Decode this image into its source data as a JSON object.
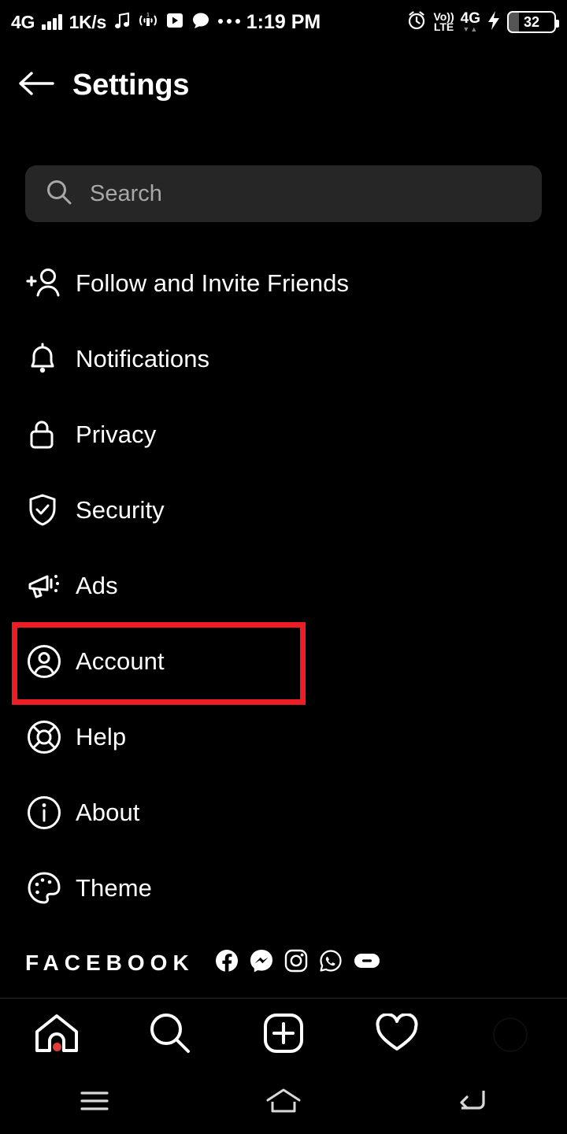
{
  "statusbar": {
    "network_type": "4G",
    "signal_icon": "signal-bars-icon",
    "data_rate": "1K/s",
    "music_icon": "music-note-icon",
    "cast_icon": "nearby-share-icon",
    "video_icon": "play-video-icon",
    "chat_icon": "chat-bubble-icon",
    "more_icon": "more-dots-icon",
    "time": "1:19 PM",
    "alarm_icon": "alarm-clock-icon",
    "volte_top": "Vo))",
    "volte_bottom": "LTE",
    "data_network": "4G",
    "data_arrows": "▼▲",
    "charging_icon": "charging-bolt-icon",
    "battery_level": "32"
  },
  "header": {
    "back_icon": "back-arrow-icon",
    "title": "Settings"
  },
  "search": {
    "icon": "search-icon",
    "placeholder": "Search",
    "value": ""
  },
  "menu": {
    "items": [
      {
        "label": "Follow and Invite Friends",
        "icon": "person-add-icon"
      },
      {
        "label": "Notifications",
        "icon": "bell-icon"
      },
      {
        "label": "Privacy",
        "icon": "lock-icon"
      },
      {
        "label": "Security",
        "icon": "shield-check-icon"
      },
      {
        "label": "Ads",
        "icon": "megaphone-icon"
      },
      {
        "label": "Account",
        "icon": "account-circle-icon"
      },
      {
        "label": "Help",
        "icon": "life-ring-icon"
      },
      {
        "label": "About",
        "icon": "info-circle-icon"
      },
      {
        "label": "Theme",
        "icon": "palette-icon"
      }
    ],
    "highlighted_item": "Account",
    "highlight_color": "#ee1c25"
  },
  "footer": {
    "brand": "FACEBOOK",
    "icons": [
      {
        "name": "facebook-icon"
      },
      {
        "name": "messenger-icon"
      },
      {
        "name": "instagram-icon"
      },
      {
        "name": "whatsapp-icon"
      },
      {
        "name": "portal-icon"
      }
    ]
  },
  "app_nav": {
    "items": [
      {
        "name": "home-tab",
        "icon": "home-icon",
        "badge": true
      },
      {
        "name": "search-tab",
        "icon": "search-icon",
        "badge": false
      },
      {
        "name": "create-tab",
        "icon": "add-square-icon",
        "badge": false
      },
      {
        "name": "activity-tab",
        "icon": "heart-icon",
        "badge": false
      },
      {
        "name": "profile-tab",
        "icon": "avatar-icon",
        "badge": false
      }
    ],
    "badge_color": "#e03c3c"
  },
  "system_nav": {
    "items": [
      {
        "name": "recents-button",
        "icon": "menu-lines-icon"
      },
      {
        "name": "home-button",
        "icon": "home-outline-icon"
      },
      {
        "name": "back-button",
        "icon": "back-return-icon"
      }
    ]
  }
}
